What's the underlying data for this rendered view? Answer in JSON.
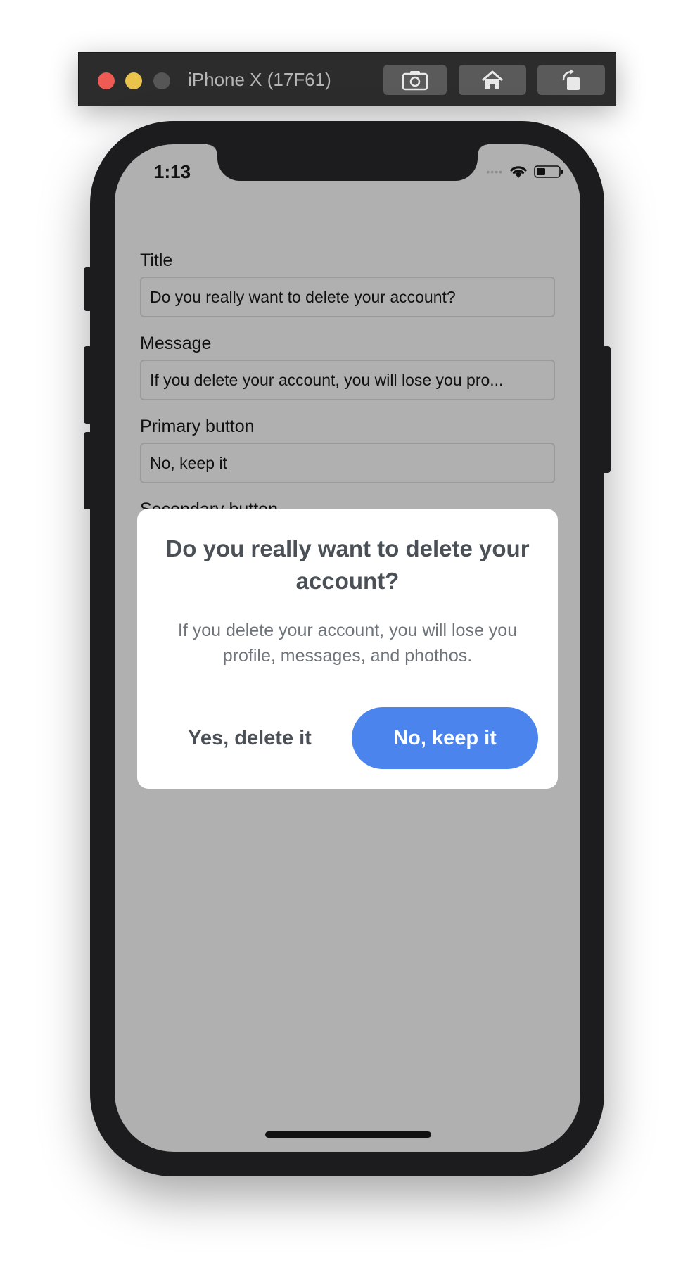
{
  "simulator": {
    "title": "iPhone X (17F61)",
    "buttons": {
      "screenshot_icon": "camera-icon",
      "home_icon": "home-icon",
      "rotate_icon": "rotate-icon"
    }
  },
  "status_bar": {
    "time": "1:13",
    "signal": "••••",
    "icons": [
      "wifi-icon",
      "battery-icon"
    ]
  },
  "form": {
    "title_label": "Title",
    "title_value": "Do you really want to delete your account?",
    "message_label": "Message",
    "message_value": "If you delete your account, you will lose you pro...",
    "primary_label": "Primary button",
    "primary_value": "No, keep it",
    "secondary_label": "Secondary button"
  },
  "dialog": {
    "title": "Do you really want to delete your account?",
    "message": "If you delete your account, you will lose you profile, messages, and phothos.",
    "secondary_button": "Yes, delete it",
    "primary_button": "No, keep it"
  },
  "colors": {
    "primary_button": "#4a84ec",
    "overlay": "#b0b0b0",
    "dialog_text": "#4a5056"
  }
}
